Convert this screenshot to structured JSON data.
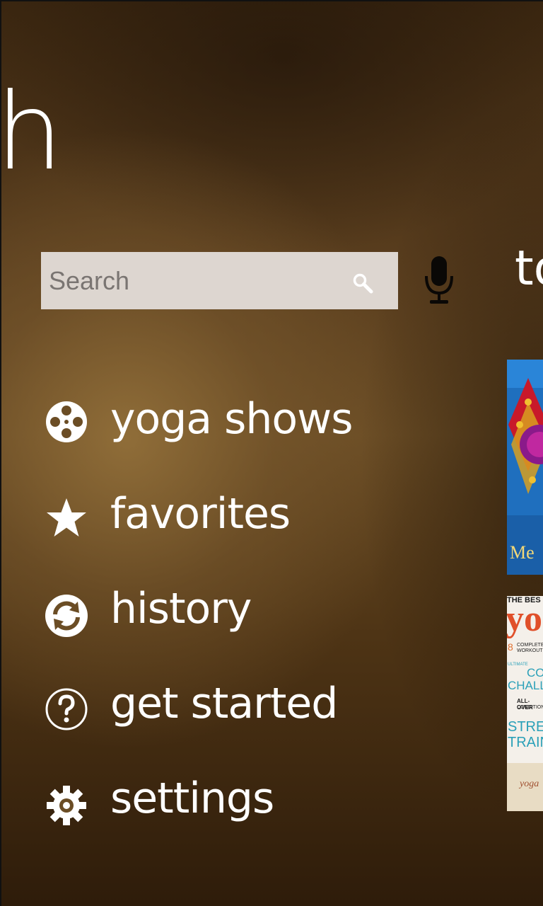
{
  "app": {
    "panorama_title_fragment": "h",
    "next_section_title_fragment": "to"
  },
  "search": {
    "placeholder": "Search",
    "value": ""
  },
  "menu": {
    "items": [
      {
        "label": "yoga shows",
        "icon": "film-reel-icon"
      },
      {
        "label": "favorites",
        "icon": "star-icon"
      },
      {
        "label": "history",
        "icon": "refresh-icon"
      },
      {
        "label": "get started",
        "icon": "help-icon"
      },
      {
        "label": "settings",
        "icon": "gear-icon"
      }
    ]
  },
  "thumbnails": [
    {
      "caption_fragment": "Me"
    },
    {
      "cover_title_fragment": "yog",
      "header_fragment": "THE BES",
      "lines": [
        "8",
        "COMPLETE",
        "WORKOUTS",
        "ULTIMATE",
        "CO",
        "CHALLE",
        "ALL-OVER",
        "CONDITION",
        "STREN",
        "TRAIN",
        "yoga"
      ]
    }
  ],
  "colors": {
    "search_bg": "#ddd6d0",
    "text": "#ffffff",
    "background": "#5a3e1e"
  }
}
